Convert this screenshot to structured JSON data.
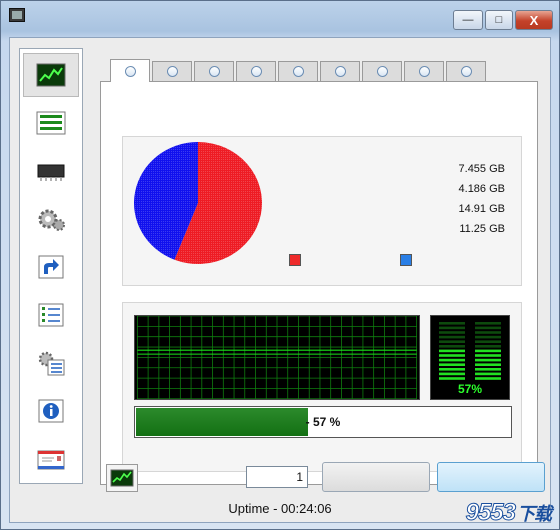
{
  "window": {
    "minimize_glyph": "—",
    "maximize_glyph": "□",
    "close_glyph": "X"
  },
  "sidebar": {
    "items": [
      {
        "name": "performance-monitor-icon",
        "active": true
      },
      {
        "name": "list-view-icon"
      },
      {
        "name": "memory-chip-icon"
      },
      {
        "name": "gears-icon"
      },
      {
        "name": "shortcut-arrow-icon"
      },
      {
        "name": "checklist-icon"
      },
      {
        "name": "settings-list-icon"
      },
      {
        "name": "info-icon"
      },
      {
        "name": "mail-icon"
      }
    ]
  },
  "tabs": {
    "count": 9,
    "active_index": 0
  },
  "memory": {
    "values": [
      "7.455 GB",
      "4.186 GB",
      "14.91 GB",
      "11.25 GB"
    ],
    "used_fraction": 0.56,
    "used_color": "#ee1c24",
    "free_color": "#1111ee",
    "legend_colors": [
      "#ee2b2b",
      "#2a7fe6"
    ]
  },
  "cpu": {
    "meter_percent": "57%",
    "progress_fraction": 0.57,
    "progress_label": "- 57 %",
    "grid_color": "#0f7f0f",
    "trace_color": "#19e019"
  },
  "footer": {
    "spin_value": "1",
    "uptime": "Uptime - 00:24:06"
  },
  "watermark": {
    "main": "9553",
    "suffix": "下载"
  }
}
